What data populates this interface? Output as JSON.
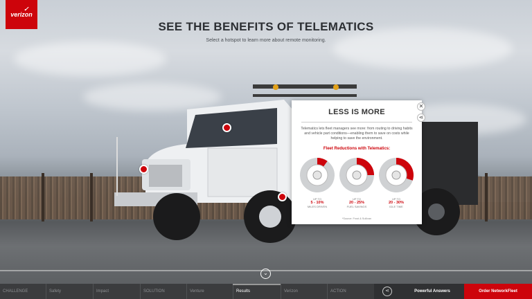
{
  "brand": {
    "logo_text": "verizon",
    "logo_mark": "✓",
    "accent": "#cd040b"
  },
  "header": {
    "title": "SEE THE BENEFITS OF TELEMATICS",
    "subtitle": "Select a hotspot to learn more about remote monitoring."
  },
  "modal": {
    "title": "LESS IS MORE",
    "body": "Telematics lets fleet managers see more: from routing to driving habits and vehicle part conditions—enabling them to save on costs while helping to save the environment.",
    "subtitle": "Fleet Reductions with Telematics:",
    "stats": [
      {
        "upto": "UP TO",
        "range": "5 - 10%",
        "label": "MILES DRIVEN",
        "fraction": 0.1
      },
      {
        "upto": "UP TO",
        "range": "20 - 25%",
        "label": "FUEL SAVINGS",
        "fraction": 0.25
      },
      {
        "upto": "UP TO",
        "range": "20 - 30%",
        "label": "IDLE TIME",
        "fraction": 0.3
      }
    ],
    "footnote": "*Source: Frost & Sullivan",
    "close_icon": "close-icon",
    "share_icon": "share-icon"
  },
  "nav": {
    "items": [
      {
        "label": "CHALLENGE"
      },
      {
        "label": "Safety"
      },
      {
        "label": "Impact"
      },
      {
        "label": "SOLUTION"
      },
      {
        "label": "Venture"
      },
      {
        "label": "Results"
      },
      {
        "label": "Verizon"
      },
      {
        "label": "ACTION"
      }
    ],
    "powerful_answers": "Powerful Answers",
    "order": "Order NetworkFleet"
  }
}
